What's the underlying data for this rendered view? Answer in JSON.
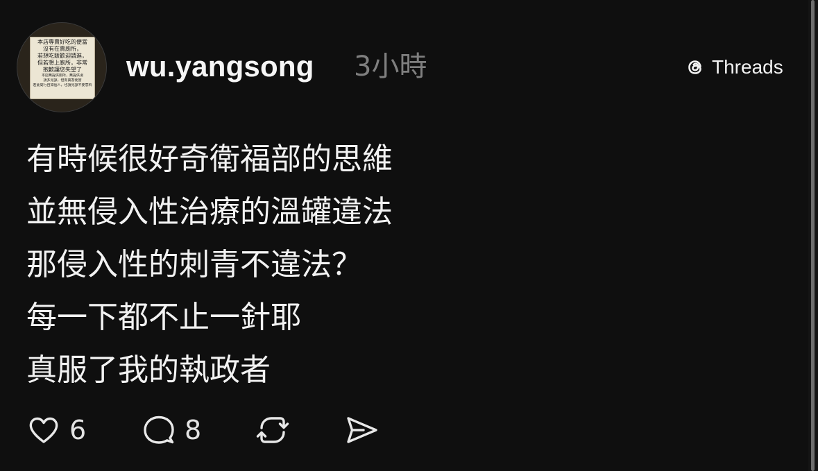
{
  "post": {
    "avatar_sign": [
      "本店專賣好吃的便當",
      "沒有在賣廁所，",
      "若想吃飯歡迎請進，",
      "但若想上廁所，非常",
      "抱歉讓您失望了",
      "本店無提供廁所，無提供湯",
      "請多見諒，但有賣香便當",
      "若此間行自如個人，也請見諒不要意料"
    ],
    "username": "wu.yangsong",
    "time": "3小時",
    "brand": {
      "label": "Threads",
      "icon": "threads-logo-icon"
    },
    "lines": [
      "有時候很好奇衛福部的思維",
      "並無侵入性治療的溫罐違法",
      "那侵入性的刺青不違法？",
      "每一下都不止一針耶",
      "真服了我的執政者"
    ],
    "actions": {
      "like": {
        "icon": "heart-icon",
        "count": "6"
      },
      "reply": {
        "icon": "comment-icon",
        "count": "8"
      },
      "repost": {
        "icon": "repost-icon"
      },
      "share": {
        "icon": "send-icon"
      }
    }
  },
  "colors": {
    "background": "#0f0f0f",
    "text": "#f3f3f3",
    "muted": "#7f7f7f"
  }
}
